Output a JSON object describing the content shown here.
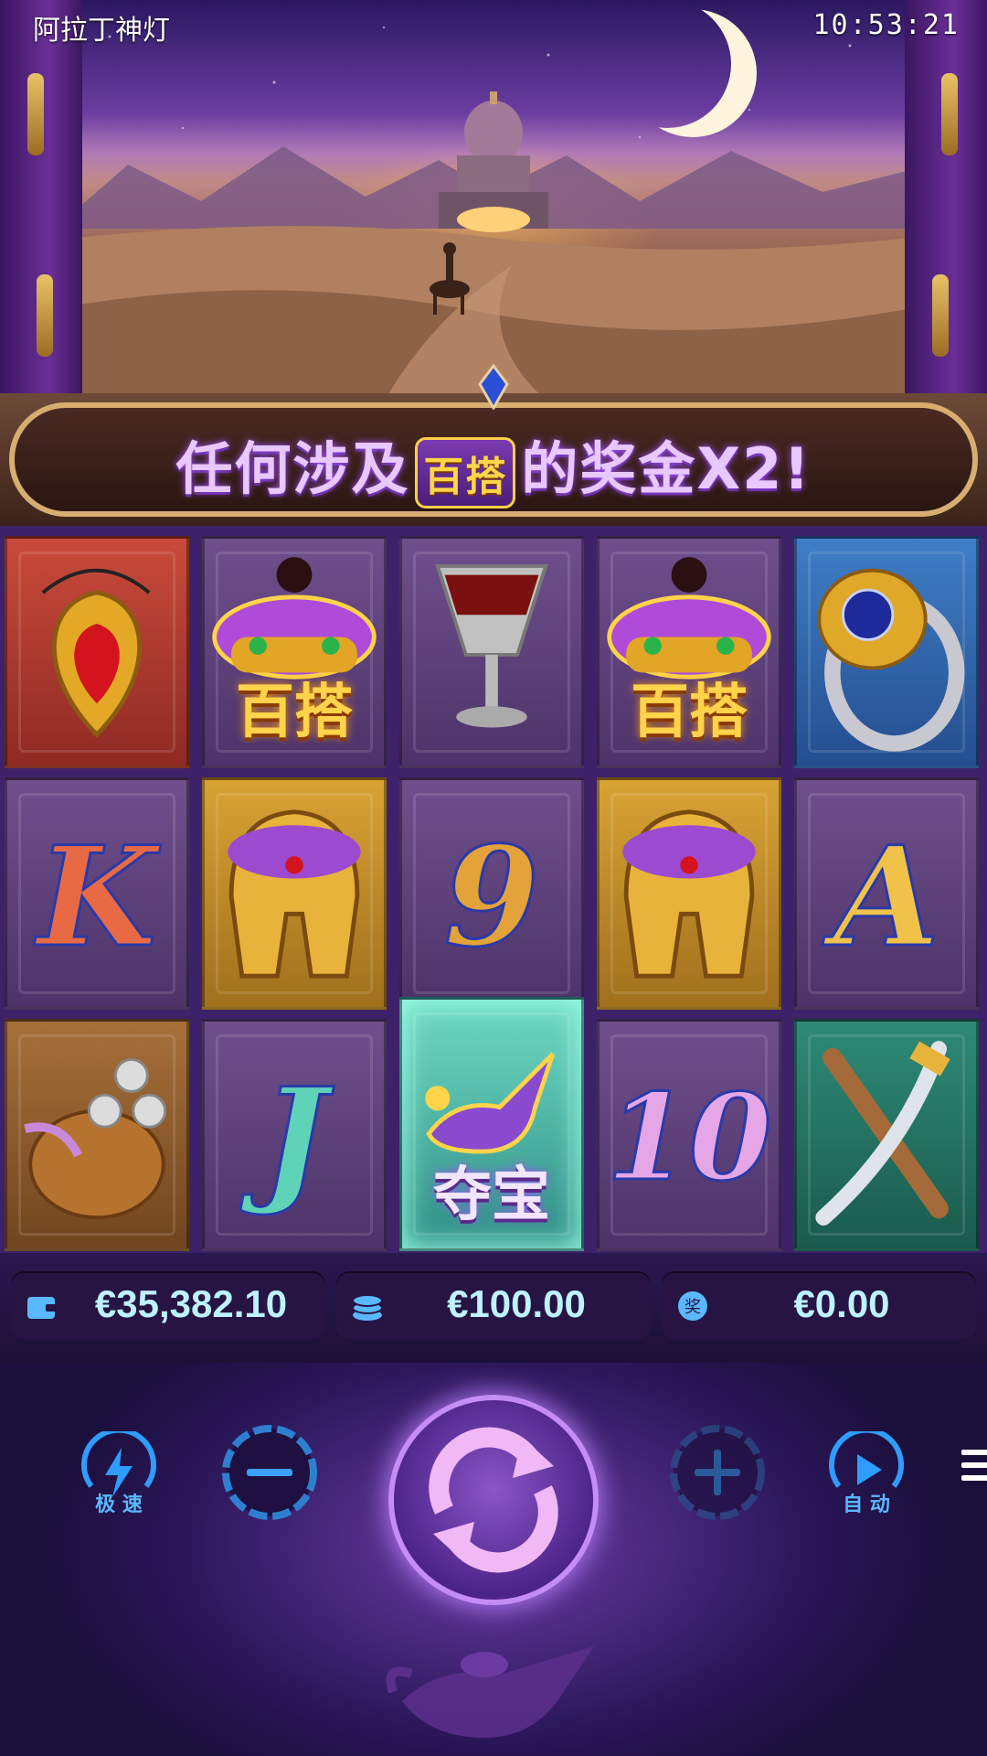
{
  "status": {
    "title": "阿拉丁神灯",
    "time": "10:53:21"
  },
  "banner": {
    "text_before": "任何涉及",
    "badge": "百搭",
    "text_after": "的奖金X2!"
  },
  "grid": {
    "row1": [
      {
        "symbol": "ruby-amulet-icon",
        "label": ""
      },
      {
        "symbol": "genie-wild-icon",
        "label": "百搭"
      },
      {
        "symbol": "goblet-icon",
        "label": ""
      },
      {
        "symbol": "genie-wild-icon",
        "label": "百搭"
      },
      {
        "symbol": "sapphire-ring-icon",
        "label": ""
      }
    ],
    "row2": [
      {
        "symbol": "letter-k",
        "label": "K"
      },
      {
        "symbol": "golden-helmet-icon",
        "label": ""
      },
      {
        "symbol": "number-9",
        "label": "9"
      },
      {
        "symbol": "golden-helmet-icon",
        "label": ""
      },
      {
        "symbol": "letter-a",
        "label": "A"
      }
    ],
    "row3": [
      {
        "symbol": "coin-sack-icon",
        "label": ""
      },
      {
        "symbol": "letter-j",
        "label": "J"
      },
      {
        "symbol": "magic-lamp-scatter-icon",
        "label": "夺宝"
      },
      {
        "symbol": "number-10",
        "label": "10"
      },
      {
        "symbol": "crossed-swords-icon",
        "label": ""
      }
    ]
  },
  "balance": {
    "wallet": "€35,382.10",
    "bet": "€100.00",
    "win": "€0.00"
  },
  "controls": {
    "turbo_label": "极 速",
    "auto_label": "自 动"
  },
  "colors": {
    "accent": "#5ab8ff",
    "value_text": "#bdf3ff",
    "gold": "#ffd34a"
  }
}
